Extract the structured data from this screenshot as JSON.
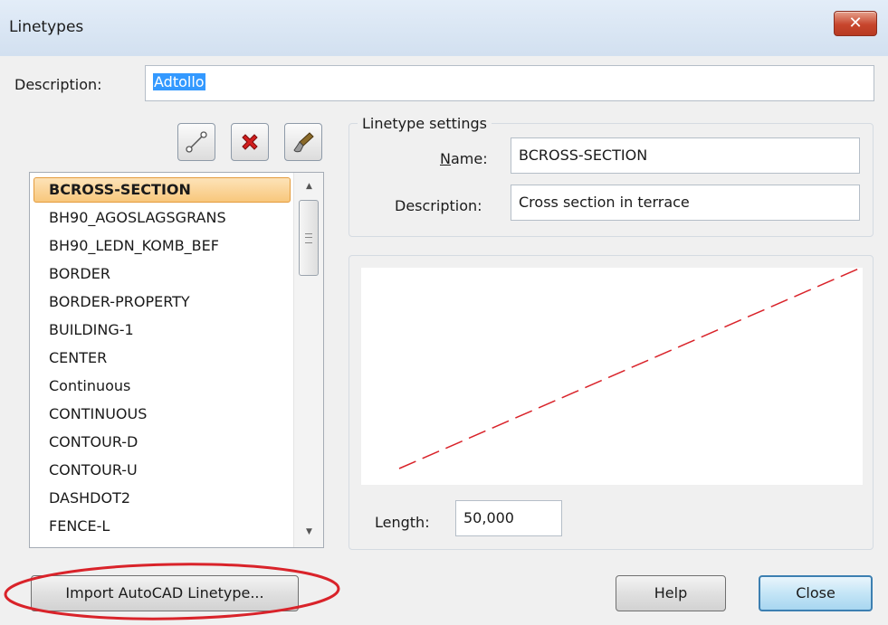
{
  "window": {
    "title": "Linetypes",
    "close_glyph": "✕"
  },
  "description": {
    "label": "Description:",
    "value": "Adtollo"
  },
  "toolbar": [
    {
      "name": "new-linetype-icon"
    },
    {
      "name": "delete-icon",
      "color": "#d21e1e"
    },
    {
      "name": "edit-brush-icon"
    }
  ],
  "linetypes": {
    "selected": "BCROSS-SECTION",
    "items": [
      "BCROSS-SECTION",
      "BH90_AGOSLAGSGRANS",
      "BH90_LEDN_KOMB_BEF",
      "BORDER",
      "BORDER-PROPERTY",
      "BUILDING-1",
      "CENTER",
      "Continuous",
      "CONTINUOUS",
      "CONTOUR-D",
      "CONTOUR-U",
      "DASHDOT2",
      "FENCE-L"
    ]
  },
  "settings": {
    "group_label": "Linetype settings",
    "name_label_prefix": "N",
    "name_label_rest": "ame:",
    "name_value": "BCROSS-SECTION",
    "description_label": "Description:",
    "description_value": "Cross section in terrace"
  },
  "preview": {
    "line_color": "#d9232a"
  },
  "length": {
    "label": "Length:",
    "value": "50,000"
  },
  "buttons": {
    "import": "Import AutoCAD Linetype...",
    "help": "Help",
    "close": "Close"
  },
  "annotation": {
    "color": "#d9232a"
  }
}
